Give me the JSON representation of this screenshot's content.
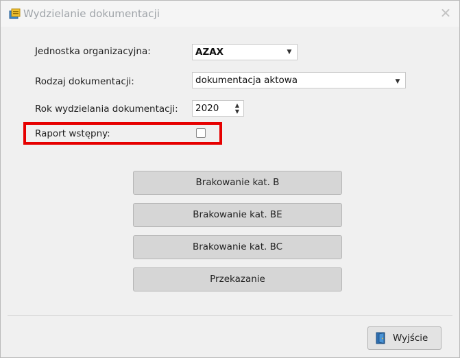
{
  "window": {
    "title": "Wydzielanie dokumentacji",
    "close_symbol": "✕"
  },
  "form": {
    "unit_label": "Jednostka organizacyjna:",
    "unit_value": "AZAX",
    "type_label": "Rodzaj dokumentacji:",
    "type_value": "dokumentacja aktowa",
    "year_label": "Rok wydzielania dokumentacji:",
    "year_value": "2020",
    "preliminary_label": "Raport wstępny:",
    "preliminary_checked": false
  },
  "buttons": [
    "Brakowanie kat. B",
    "Brakowanie kat. BE",
    "Brakowanie kat. BC",
    "Przekazanie"
  ],
  "footer": {
    "exit_label": "Wyjście"
  },
  "icons": {
    "app": "app-icon",
    "close": "close-icon",
    "dropdown": "chevron-down-icon",
    "spin": "spin-arrows-icon",
    "exit": "exit-door-icon"
  },
  "colors": {
    "highlight": "#e60000",
    "button_bg": "#d6d6d6",
    "window_bg": "#f0f0f0"
  }
}
